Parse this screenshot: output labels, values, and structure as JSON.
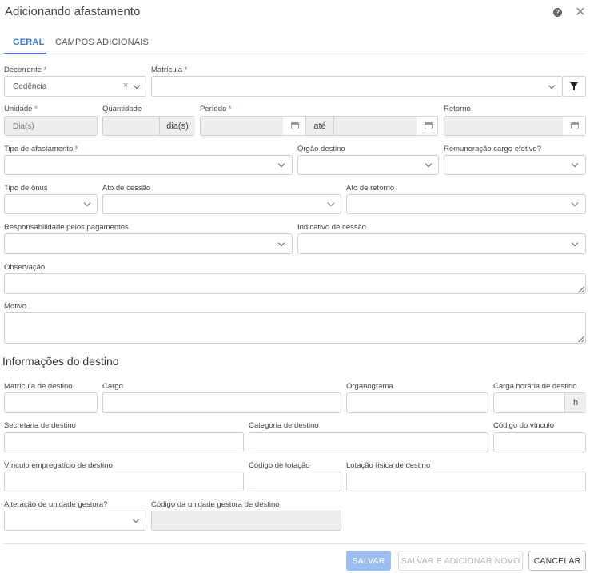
{
  "header": {
    "title": "Adicionando afastamento",
    "help_icon": "question-circle-icon",
    "close_icon": "close-icon"
  },
  "tabs": [
    {
      "label": "GERAL",
      "active": true
    },
    {
      "label": "CAMPOS ADICIONAIS",
      "active": false
    }
  ],
  "fields": {
    "decorrente": {
      "label": "Decorrente",
      "value": "Cedência"
    },
    "matricula": {
      "label": "Matrícula",
      "value": ""
    },
    "unidade": {
      "label": "Unidade",
      "value": "Dia(s)"
    },
    "quantidade": {
      "label": "Quantidade",
      "addon": "dia(s)"
    },
    "periodo": {
      "label": "Período",
      "separator": "até"
    },
    "retorno": {
      "label": "Retorno"
    },
    "tipo_afastamento": {
      "label": "Tipo de afastamento"
    },
    "orgao_destino": {
      "label": "Órgão destino"
    },
    "remuneracao": {
      "label": "Remuneração cargo efetivo?"
    },
    "tipo_onus": {
      "label": "Tipo de ônus"
    },
    "ato_cessao": {
      "label": "Ato de cessão"
    },
    "ato_retorno": {
      "label": "Ato de retorno"
    },
    "responsabilidade": {
      "label": "Responsabilidade pelos pagamentos"
    },
    "indicativo_cessao": {
      "label": "Indicativo de cessão"
    },
    "observacao": {
      "label": "Observação"
    },
    "motivo": {
      "label": "Motivo"
    }
  },
  "destino": {
    "title": "Informações do destino",
    "matricula_destino": {
      "label": "Matrícula de destino"
    },
    "cargo": {
      "label": "Cargo"
    },
    "organograma": {
      "label": "Organograma"
    },
    "carga_horaria": {
      "label": "Carga horária de destino",
      "addon": "h"
    },
    "secretaria": {
      "label": "Secretaria de destino"
    },
    "categoria": {
      "label": "Categoria de destino"
    },
    "codigo_vinculo": {
      "label": "Código do vínculo"
    },
    "vinculo_empregaticio": {
      "label": "Vínculo empregatício de destino"
    },
    "codigo_lotacao": {
      "label": "Código de lotação"
    },
    "lotacao_fisica": {
      "label": "Lotação física de destino"
    },
    "alteracao_unidade": {
      "label": "Alteração de unidade gestora?"
    },
    "codigo_unidade_gestora": {
      "label": "Código da unidade gestora de destino"
    }
  },
  "footer": {
    "save": "SALVAR",
    "save_new": "SALVAR E ADICIONAR NOVO",
    "cancel": "CANCELAR"
  },
  "colors": {
    "accent": "#3a7bd5",
    "required": "#d9534f",
    "disabled_bg": "#eeeeee"
  }
}
